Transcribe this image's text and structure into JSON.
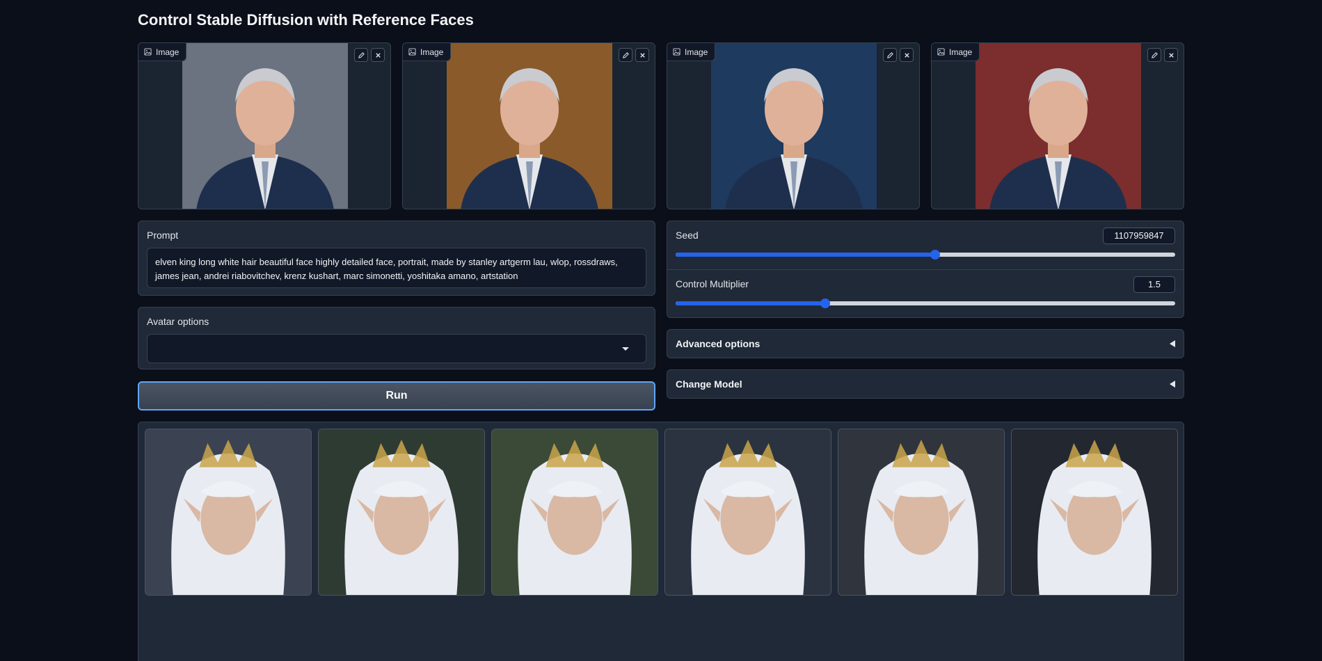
{
  "app": {
    "title": "Control Stable Diffusion with Reference Faces"
  },
  "reference_images": [
    {
      "label": "Image",
      "edit_label": "edit",
      "clear_label": "clear",
      "bg": "#6b7280"
    },
    {
      "label": "Image",
      "edit_label": "edit",
      "clear_label": "clear",
      "bg": "#8a5a2b"
    },
    {
      "label": "Image",
      "edit_label": "edit",
      "clear_label": "clear",
      "bg": "#1e3a5f"
    },
    {
      "label": "Image",
      "edit_label": "edit",
      "clear_label": "clear",
      "bg": "#7c2d2d"
    }
  ],
  "prompt": {
    "label": "Prompt",
    "value": "elven king long white hair beautiful face highly detailed face, portrait, made by stanley artgerm lau, wlop, rossdraws, james jean, andrei riabovitchev, krenz kushart, marc simonetti, yoshitaka amano, artstation"
  },
  "avatar": {
    "label": "Avatar options",
    "value": ""
  },
  "run": {
    "label": "Run"
  },
  "seed": {
    "label": "Seed",
    "value": "1107959847",
    "fraction": 0.52
  },
  "control_multiplier": {
    "label": "Control Multiplier",
    "value": "1.5",
    "fraction": 0.3
  },
  "advanced": {
    "label": "Advanced options"
  },
  "change_model": {
    "label": "Change Model"
  },
  "gallery": [
    {
      "bg": "#3b4252"
    },
    {
      "bg": "#2e3b33"
    },
    {
      "bg": "#3a4a36"
    },
    {
      "bg": "#2c3340"
    },
    {
      "bg": "#30343c"
    },
    {
      "bg": "#23272f"
    }
  ],
  "colors": {
    "accent": "#2563eb",
    "background": "#0b0f19",
    "panel": "#1f2937",
    "focus": "#60a5fa"
  }
}
